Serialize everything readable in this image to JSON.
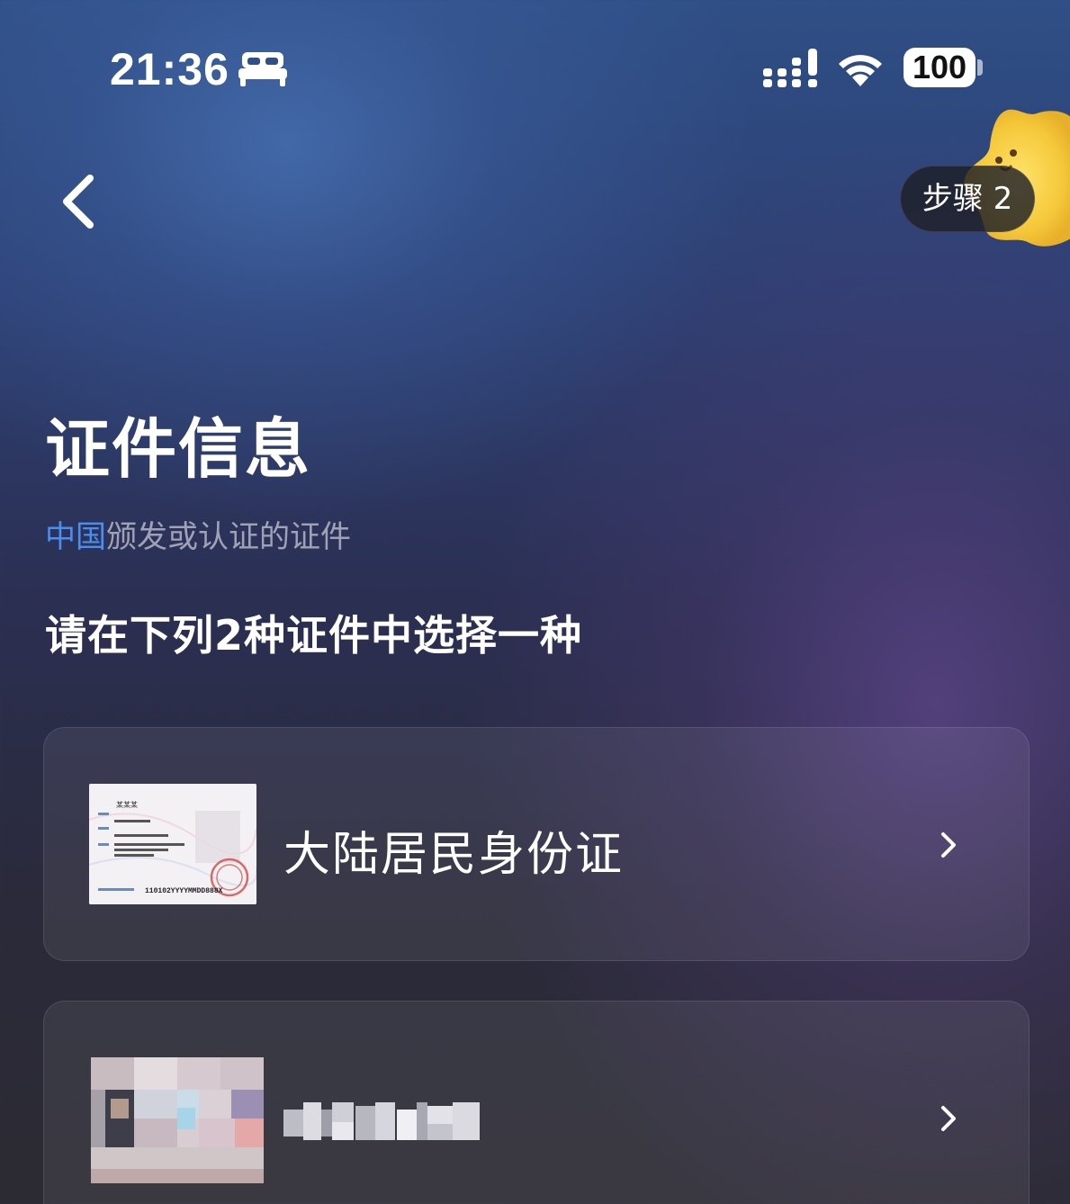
{
  "status_bar": {
    "time": "21:36",
    "battery": "100",
    "icons": [
      "bed-icon",
      "cellular-signal-icon",
      "wifi-icon",
      "battery-icon"
    ]
  },
  "nav": {
    "back_icon": "chevron-left-icon",
    "step_label": "步骤 2"
  },
  "page": {
    "title": "证件信息",
    "subtitle_country": "中国",
    "subtitle_rest": "颁发或认证的证件",
    "instruction": "请在下列2种证件中选择一种"
  },
  "options": [
    {
      "label": "大陆居民身份证",
      "thumbnail": "id-card-image",
      "id_number": "110102YYYYMMDD888X",
      "name_sample": "某某某",
      "icon": "chevron-right-icon"
    },
    {
      "label": "",
      "label_redacted": true,
      "thumbnail": "passport-image-pixelated",
      "icon": "chevron-right-icon"
    }
  ],
  "colors": {
    "accent_blue": "#4a8ff0",
    "text_primary": "#ffffff",
    "text_secondary": "rgba(255,255,255,0.55)"
  }
}
